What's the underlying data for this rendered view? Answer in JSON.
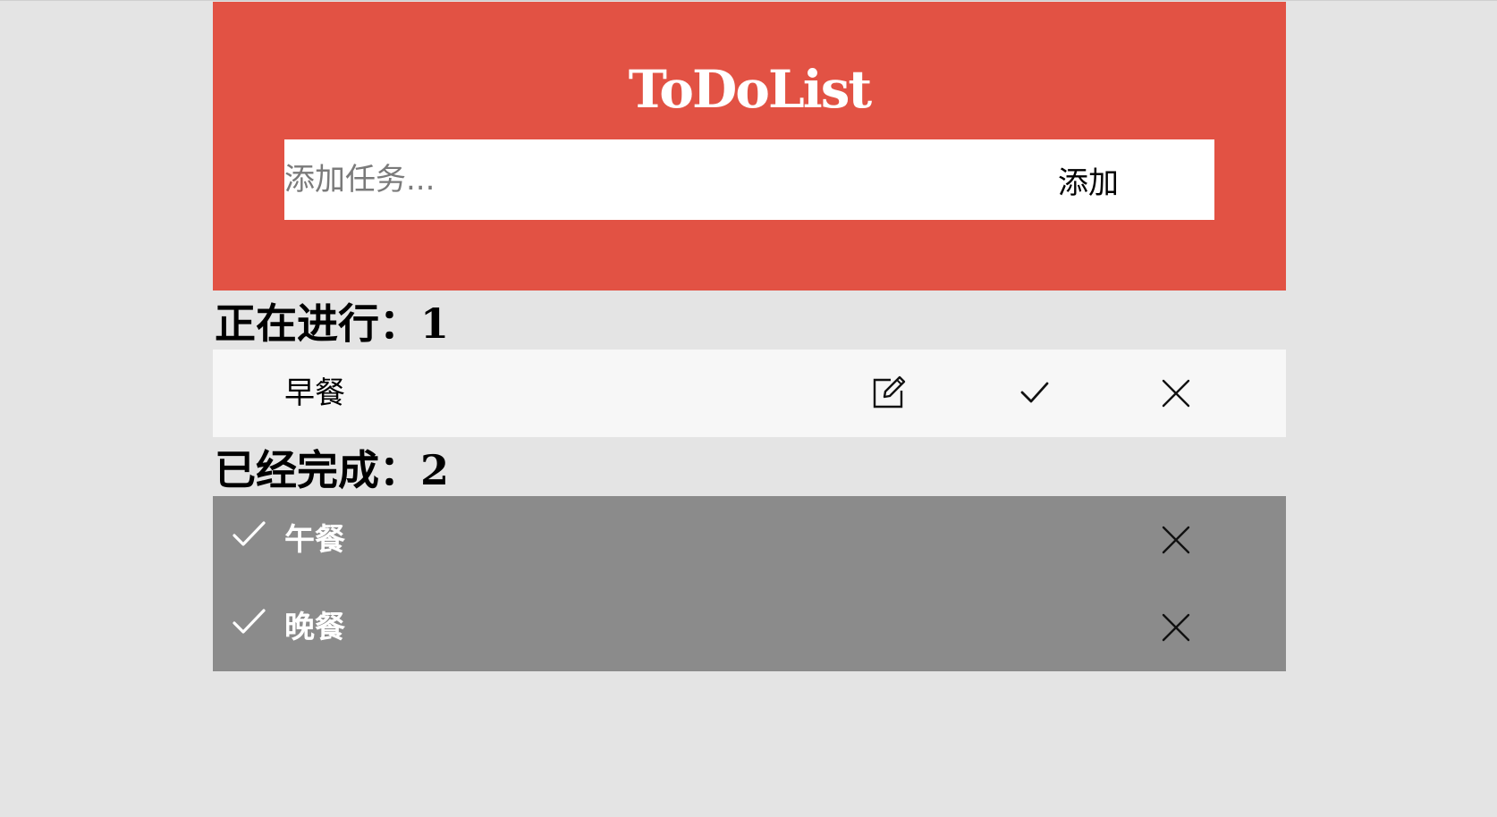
{
  "app": {
    "title": "ToDoList"
  },
  "add_bar": {
    "placeholder": "添加任务...",
    "button_label": "添加"
  },
  "ongoing": {
    "heading": "正在进行：",
    "count": "1",
    "items": [
      {
        "text": "早餐",
        "icons": [
          "edit-icon",
          "check-icon",
          "close-icon"
        ]
      }
    ]
  },
  "completed": {
    "heading": "已经完成：",
    "count": "2",
    "items": [
      {
        "text": "午餐",
        "icons": [
          "check-icon",
          "close-icon"
        ]
      },
      {
        "text": "晚餐",
        "icons": [
          "check-icon",
          "close-icon"
        ]
      }
    ]
  },
  "colors": {
    "header_bg": "#e25244",
    "page_bg": "#e4e4e4",
    "ongoing_row_bg": "#f7f7f7",
    "completed_bg": "#8b8b8b"
  }
}
